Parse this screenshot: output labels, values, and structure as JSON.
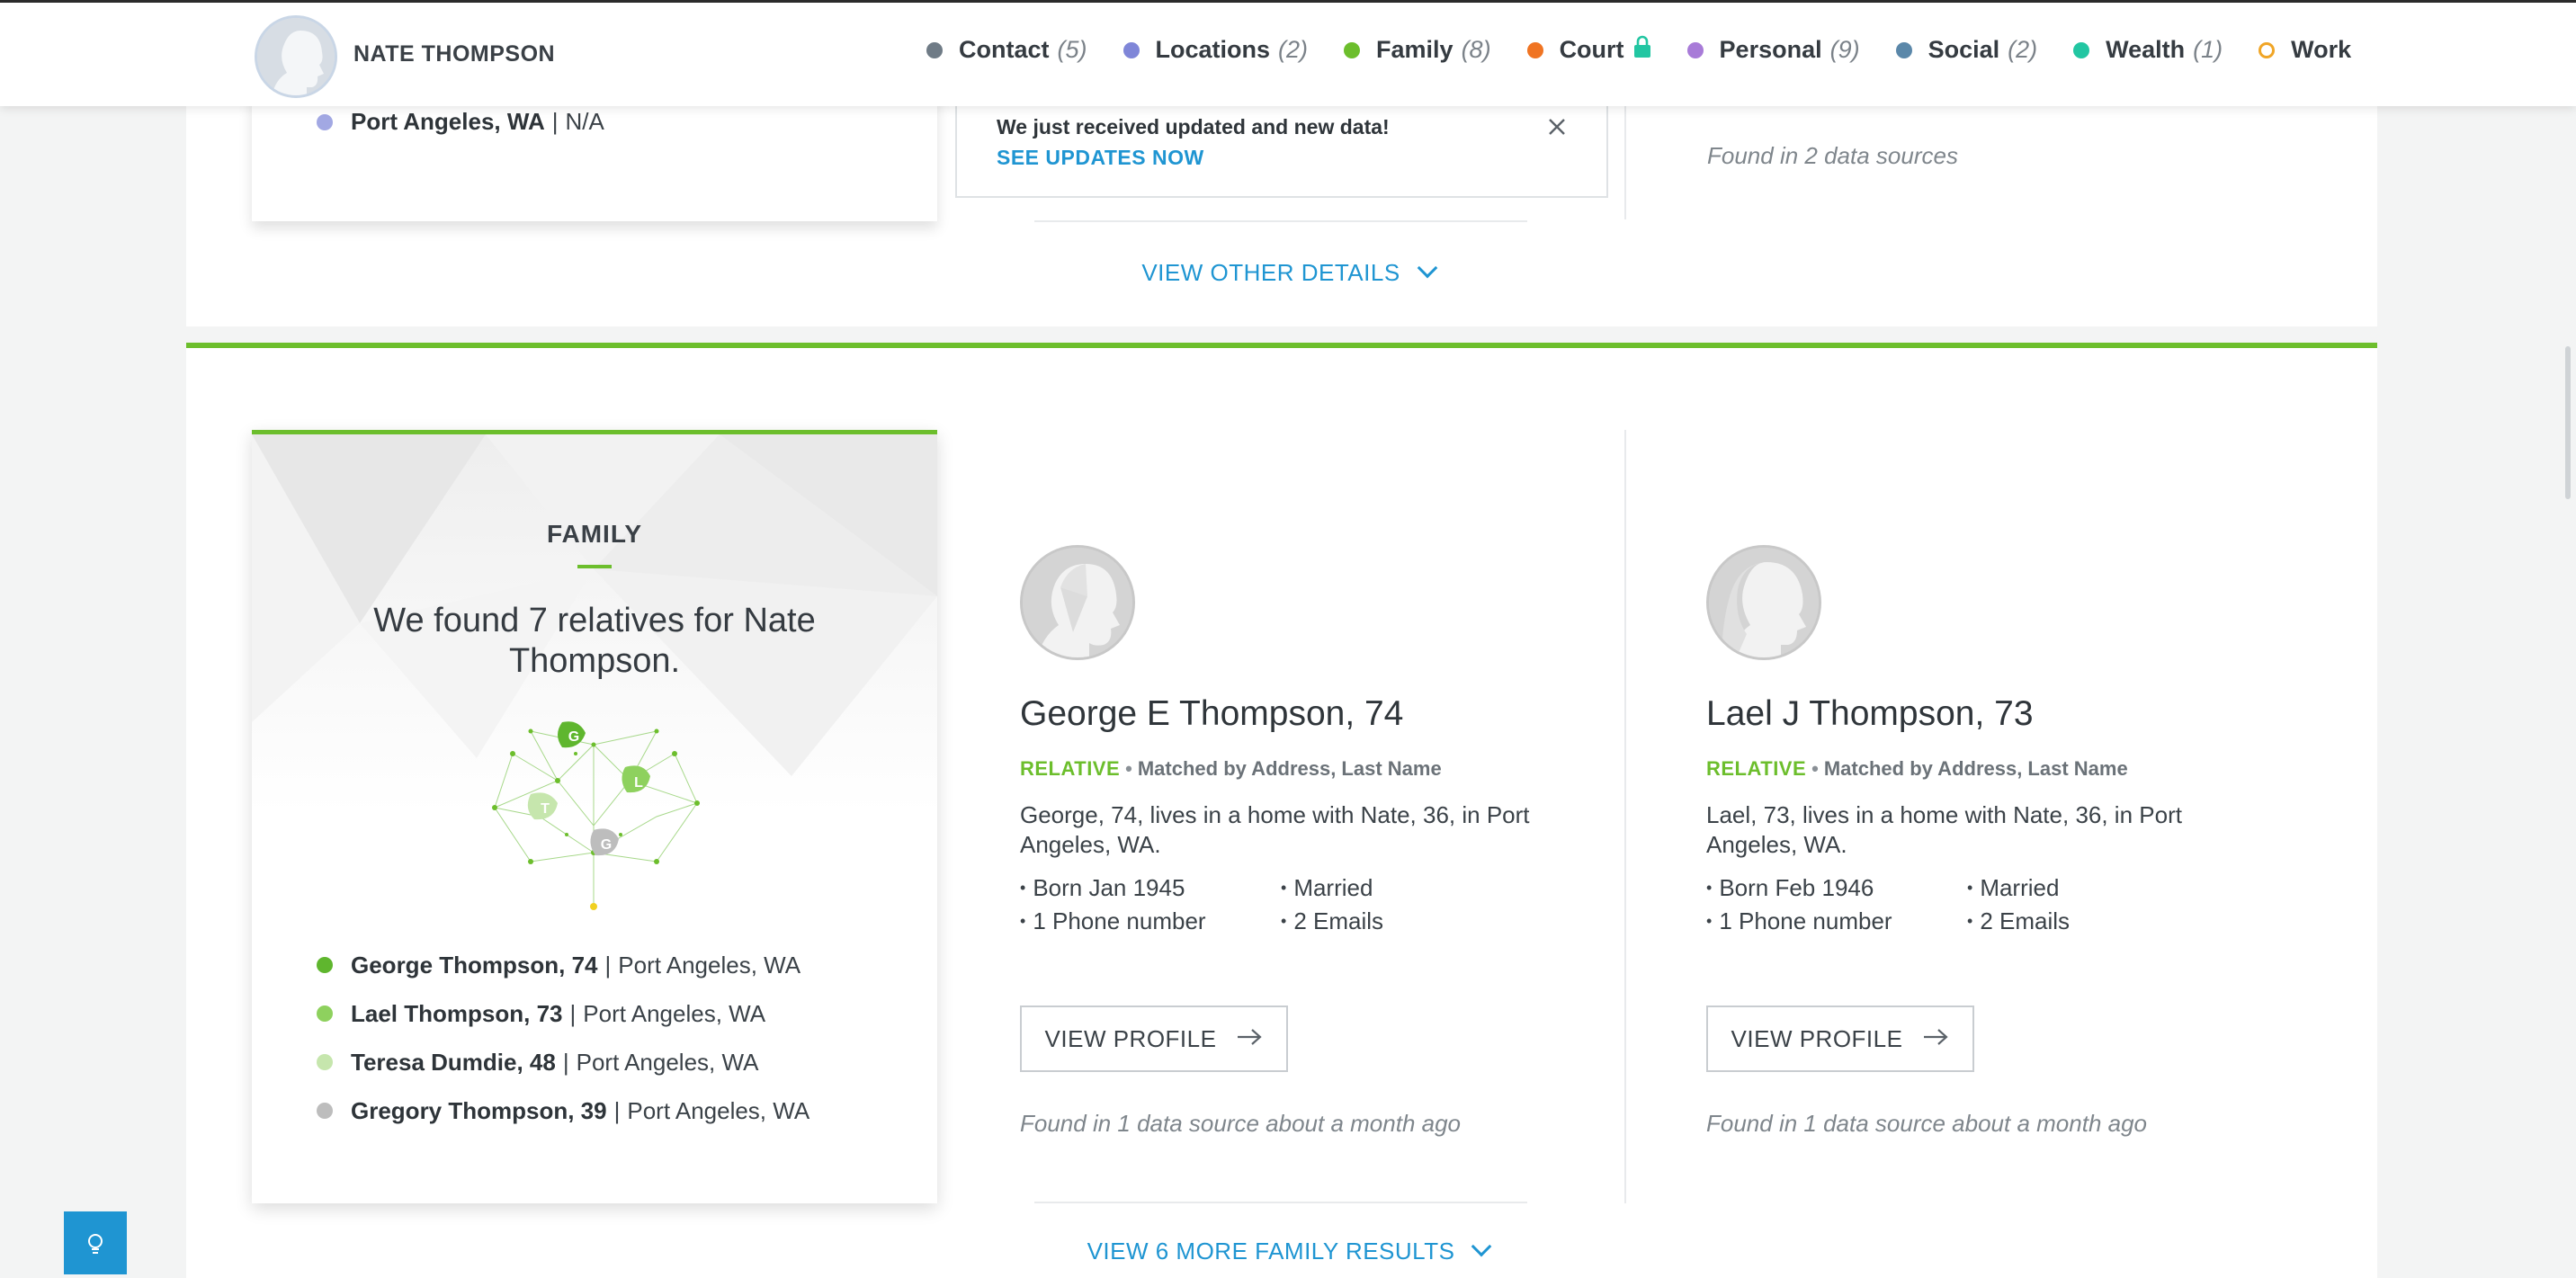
{
  "header": {
    "name": "NATE THOMPSON",
    "nav": [
      {
        "label": "Contact",
        "count": "(5)",
        "color": "#6f7b86",
        "hollow": false,
        "locked": false
      },
      {
        "label": "Locations",
        "count": "(2)",
        "color": "#7f86d8",
        "hollow": false,
        "locked": false
      },
      {
        "label": "Family",
        "count": "(8)",
        "color": "#6cbe2c",
        "hollow": false,
        "locked": false
      },
      {
        "label": "Court",
        "count": "",
        "color": "#f07422",
        "hollow": false,
        "locked": true
      },
      {
        "label": "Personal",
        "count": "(9)",
        "color": "#a87bd8",
        "hollow": false,
        "locked": false
      },
      {
        "label": "Social",
        "count": "(2)",
        "color": "#5a87a9",
        "hollow": false,
        "locked": false
      },
      {
        "label": "Wealth",
        "count": "(1)",
        "color": "#22c6a2",
        "hollow": false,
        "locked": false
      },
      {
        "label": "Work",
        "count": "",
        "color": "#f0a526",
        "hollow": true,
        "locked": false
      }
    ]
  },
  "notice": {
    "message": "We just received updated and new data!",
    "link": "SEE UPDATES NOW"
  },
  "locations_section": {
    "item_name": "Port Angeles, WA",
    "item_sep": "|",
    "item_value": "N/A",
    "item_color": "#a2a8e3",
    "found": "Found in 2 data sources",
    "view_other": "VIEW OTHER DETAILS"
  },
  "family": {
    "heading": "FAMILY",
    "summary": "We found 7 relatives for Nate Thompson.",
    "relatives": [
      {
        "name": "George Thompson, 74",
        "place": "Port Angeles, WA",
        "color": "#5fb62e"
      },
      {
        "name": "Lael Thompson, 73",
        "place": "Port Angeles, WA",
        "color": "#8ed15e"
      },
      {
        "name": "Teresa Dumdie, 48",
        "place": "Port Angeles, WA",
        "color": "#c6e6ad"
      },
      {
        "name": "Gregory Thompson, 39",
        "place": "Port Angeles, WA",
        "color": "#bdbdbd"
      }
    ],
    "sep": "|",
    "tree_letters": [
      "G",
      "L",
      "T",
      "G"
    ],
    "people": [
      {
        "name": "George E Thompson, 74",
        "relation": "RELATIVE",
        "match": "Matched by Address, Last Name",
        "desc": "George, 74, lives in a home with Nate, 36, in Port Angeles, WA.",
        "facts": [
          "Born Jan 1945",
          "Married",
          "1 Phone number",
          "2 Emails"
        ],
        "button": "VIEW PROFILE",
        "found": "Found in 1 data source about a month ago"
      },
      {
        "name": "Lael J Thompson, 73",
        "relation": "RELATIVE",
        "match": "Matched by Address, Last Name",
        "desc": "Lael, 73, lives in a home with Nate, 36, in Port Angeles, WA.",
        "facts": [
          "Born Feb 1946",
          "Married",
          "1 Phone number",
          "2 Emails"
        ],
        "button": "VIEW PROFILE",
        "found": "Found in 1 data source about a month ago"
      }
    ],
    "view_more": "VIEW 6 MORE FAMILY RESULTS"
  },
  "icons": {
    "help": "lightbulb-icon",
    "close": "close-icon",
    "lock": "lock-icon",
    "arrow": "arrow-right-icon",
    "chevron": "chevron-down-icon"
  },
  "colors": {
    "accent": "#1f95d2",
    "family_green": "#6cbe2c"
  }
}
